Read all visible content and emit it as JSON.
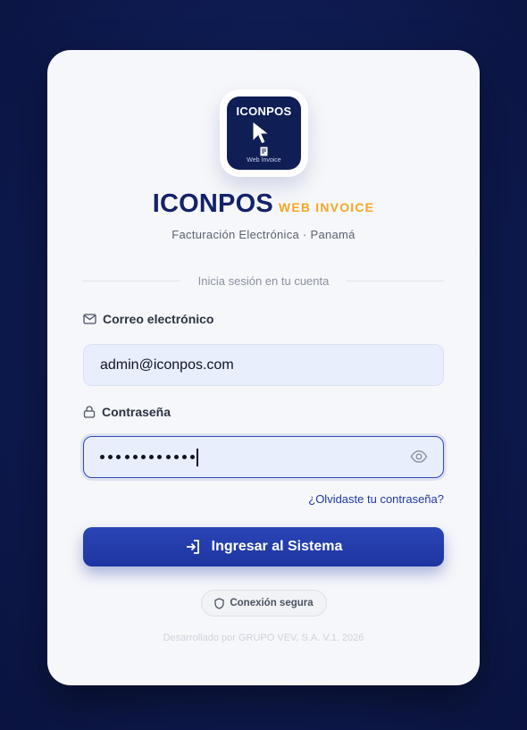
{
  "logo": {
    "title": "ICONPOS",
    "subtitle": "Web Invoice",
    "icon": "cursor-icon"
  },
  "brand": {
    "name": "ICONPOS",
    "accent": "WEB INVOICE",
    "tagline": "Facturación Electrónica · Panamá"
  },
  "form": {
    "divider_text": "Inicia sesión en tu cuenta",
    "email": {
      "label": "Correo electrónico",
      "value": "admin@iconpos.com",
      "icon": "mail-icon"
    },
    "password": {
      "label": "Contraseña",
      "masked_length": 12,
      "icon": "lock-icon",
      "toggle_icon": "eye-icon"
    },
    "forgot_link": "¿Olvidaste tu contraseña?",
    "submit_label": "Ingresar al Sistema",
    "submit_icon": "login-icon"
  },
  "secure_badge": {
    "label": "Conexión segura",
    "icon": "shield-icon"
  },
  "footer": "Desarrollado por GRUPO VEV, S.A. V.1. 2026",
  "colors": {
    "primary": "#1d35a0",
    "brand_navy": "#13226a",
    "accent": "#f5a623",
    "background": "#0f1d55"
  }
}
